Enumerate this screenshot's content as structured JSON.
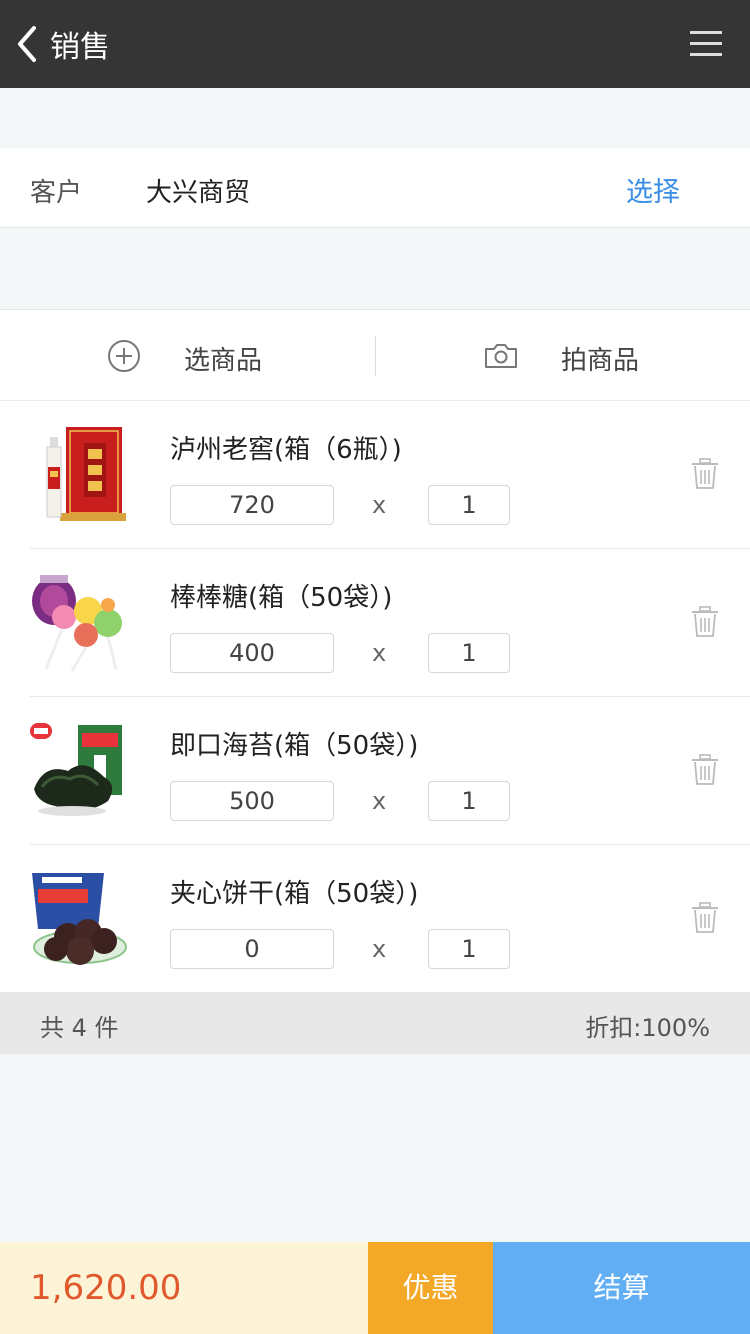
{
  "header": {
    "title": "销售",
    "back_icon": "chevron-left-icon",
    "menu_icon": "hamburger-menu-icon"
  },
  "customer": {
    "label": "客户",
    "value": "大兴商贸",
    "select_label": "选择"
  },
  "actions": {
    "pick_label": "选商品",
    "pick_icon": "plus-circle-icon",
    "photo_label": "拍商品",
    "photo_icon": "camera-icon"
  },
  "products": [
    {
      "name": "泸州老窖(箱（6瓶）)",
      "price": "720",
      "times": "x",
      "qty": "1",
      "thumb": "liquor-box-image"
    },
    {
      "name": "棒棒糖(箱（50袋）)",
      "price": "400",
      "times": "x",
      "qty": "1",
      "thumb": "lollipop-image"
    },
    {
      "name": "即口海苔(箱（50袋）)",
      "price": "500",
      "times": "x",
      "qty": "1",
      "thumb": "seaweed-image"
    },
    {
      "name": "夹心饼干(箱（50袋）)",
      "price": "0",
      "times": "x",
      "qty": "1",
      "thumb": "cookie-image"
    }
  ],
  "summary": {
    "total_count": "共 4 件",
    "discount": "折扣:100%"
  },
  "footer": {
    "amount": "1,620.00",
    "promo_label": "优惠",
    "checkout_label": "结算"
  },
  "colors": {
    "header_bg": "#353535",
    "link_blue": "#3a8ee6",
    "amount_red": "#e0582c",
    "promo_orange": "#f4a827",
    "checkout_blue": "#62aef5"
  }
}
